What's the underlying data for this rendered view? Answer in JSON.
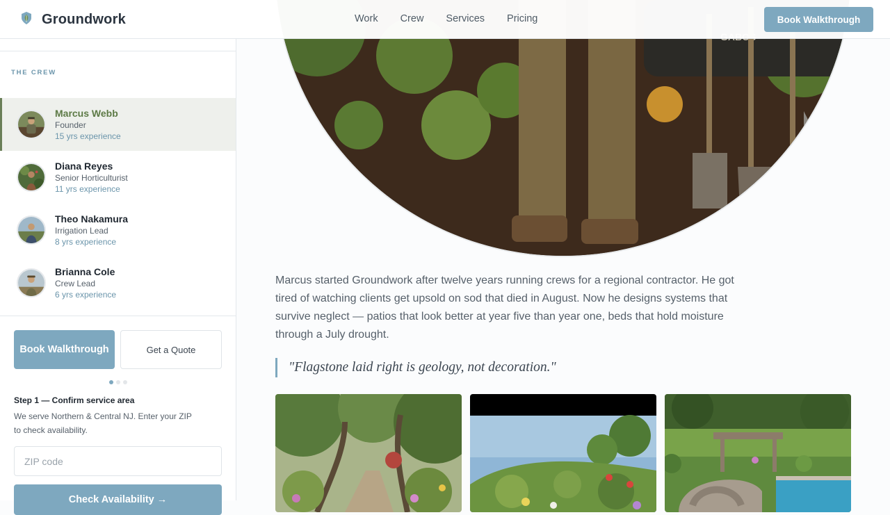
{
  "header": {
    "brand": "Groundwork",
    "logo_icon": "shield-leaf-icon",
    "nav": [
      "Work",
      "Crew",
      "Services",
      "Pricing"
    ],
    "cta": "Book Walkthrough"
  },
  "sidebar": {
    "heading": "THE CREW",
    "crew": [
      {
        "name": "Marcus Webb",
        "role": "Founder",
        "experience": "15 yrs experience",
        "active": true
      },
      {
        "name": "Diana Reyes",
        "role": "Senior Horticulturist",
        "experience": "11 yrs experience",
        "active": false
      },
      {
        "name": "Theo Nakamura",
        "role": "Irrigation Lead",
        "experience": "8 yrs experience",
        "active": false
      },
      {
        "name": "Brianna Cole",
        "role": "Crew Lead",
        "experience": "6 yrs experience",
        "active": false
      }
    ],
    "book_button": "Book Walkthrough",
    "quote_button": "Get a Quote",
    "step_title": "Step 1 — Confirm service area",
    "step_desc": "We serve Northern & Central NJ. Enter your ZIP to check availability.",
    "zip_placeholder": "ZIP code",
    "check_button": "Check Availability →",
    "steps_total": 3,
    "step_current": 1
  },
  "main": {
    "hero_alt_text": "GABOS",
    "bio": "Marcus started Groundwork after twelve years running crews for a regional contractor. He got tired of watching clients get upsold on sod that died in August. Now he designs systems that survive neglect — patios that look better at year five than year one, beds that hold moisture through a July drought.",
    "quote": "\"Flagstone laid right is geology, not decoration.\""
  },
  "colors": {
    "accent": "#7ea8bf",
    "active_green": "#5d7a46",
    "text": "#2b3440",
    "muted": "#56606a"
  }
}
